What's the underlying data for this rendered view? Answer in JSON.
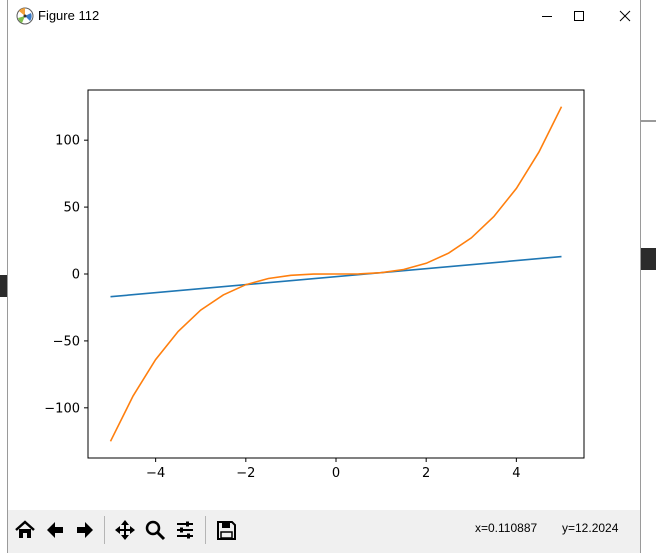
{
  "window": {
    "title": "Figure 112",
    "buttons": {
      "minimize": "minimize-icon",
      "maximize": "maximize-icon",
      "close": "close-icon"
    }
  },
  "toolbar": {
    "buttons": [
      "home-icon",
      "back-icon",
      "forward-icon",
      "pan-icon",
      "zoom-icon",
      "configure-subplots-icon",
      "save-icon"
    ],
    "x_readout": "x=0.110887",
    "y_readout": "y=12.2024"
  },
  "colors": {
    "series1": "#1f77b4",
    "series2": "#ff7f0e"
  },
  "chart_data": {
    "type": "line",
    "xlim": [
      -5.5,
      5.5
    ],
    "ylim": [
      -137.5,
      137.5
    ],
    "xticks": [
      -4,
      -2,
      0,
      2,
      4
    ],
    "xtick_labels": [
      "−4",
      "−2",
      "0",
      "2",
      "4"
    ],
    "yticks": [
      -100,
      -50,
      0,
      50,
      100
    ],
    "ytick_labels": [
      "−100",
      "−50",
      "0",
      "50",
      "100"
    ],
    "grid": false,
    "series": [
      {
        "x": [
          -5,
          5
        ],
        "y": [
          -17,
          13
        ]
      },
      {
        "x": [
          -5,
          -4.5,
          -4,
          -3.5,
          -3,
          -2.5,
          -2,
          -1.5,
          -1,
          -0.5,
          0,
          0.5,
          1,
          1.5,
          2,
          2.5,
          3,
          3.5,
          4,
          4.5,
          5
        ],
        "y": [
          -125,
          -91.1,
          -64,
          -42.9,
          -27,
          -15.6,
          -8,
          -3.4,
          -1,
          -0.1,
          0,
          0.1,
          1,
          3.4,
          8,
          15.6,
          27,
          42.9,
          64,
          91.1,
          125
        ]
      }
    ]
  }
}
